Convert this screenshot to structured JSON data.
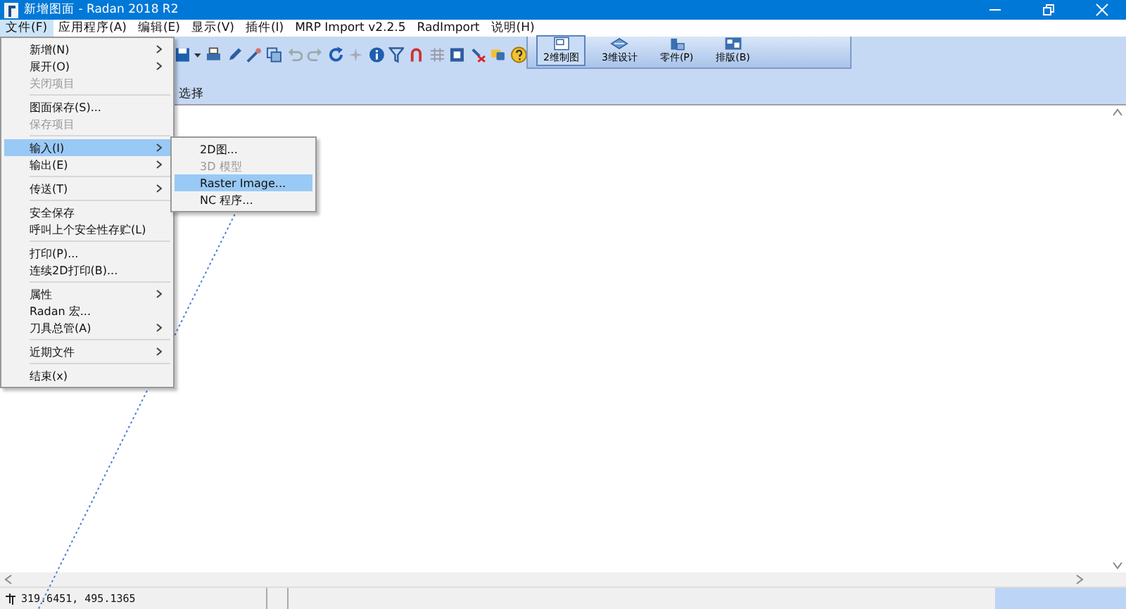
{
  "window": {
    "title": "新增图面 - Radan 2018 R2"
  },
  "menu_bar": [
    {
      "label": "文件(F)",
      "selected": true
    },
    {
      "label": "应用程序(A)",
      "selected": false
    },
    {
      "label": "编辑(E)",
      "selected": false
    },
    {
      "label": "显示(V)",
      "selected": false
    },
    {
      "label": "插件(I)",
      "selected": false
    },
    {
      "label": "MRP Import v2.2.5",
      "selected": false
    },
    {
      "label": "RadImport",
      "selected": false
    },
    {
      "label": "说明(H)",
      "selected": false
    }
  ],
  "ribbon_buttons": [
    {
      "label": "2维制图",
      "selected": true
    },
    {
      "label": "3维设计",
      "selected": false
    },
    {
      "label": "零件(P)",
      "selected": false
    },
    {
      "label": "排版(B)",
      "selected": false
    }
  ],
  "second_toolbar": {
    "label": "选择"
  },
  "file_menu": [
    {
      "kind": "item",
      "label": "新增(N)",
      "submenu": true,
      "disabled": false,
      "selected": false
    },
    {
      "kind": "item",
      "label": "展开(O)",
      "submenu": true,
      "disabled": false,
      "selected": false
    },
    {
      "kind": "item",
      "label": "关闭项目",
      "submenu": false,
      "disabled": true,
      "selected": false
    },
    {
      "kind": "separator"
    },
    {
      "kind": "item",
      "label": "图面保存(S)...",
      "submenu": false,
      "disabled": false,
      "selected": false
    },
    {
      "kind": "item",
      "label": "保存项目",
      "submenu": false,
      "disabled": true,
      "selected": false
    },
    {
      "kind": "separator"
    },
    {
      "kind": "item",
      "label": "输入(I)",
      "submenu": true,
      "disabled": false,
      "selected": true
    },
    {
      "kind": "item",
      "label": "输出(E)",
      "submenu": true,
      "disabled": false,
      "selected": false
    },
    {
      "kind": "separator"
    },
    {
      "kind": "item",
      "label": "传送(T)",
      "submenu": true,
      "disabled": false,
      "selected": false
    },
    {
      "kind": "separator"
    },
    {
      "kind": "item",
      "label": "安全保存",
      "submenu": false,
      "disabled": false,
      "selected": false
    },
    {
      "kind": "item",
      "label": "呼叫上个安全性存贮(L)",
      "submenu": false,
      "disabled": false,
      "selected": false
    },
    {
      "kind": "separator"
    },
    {
      "kind": "item",
      "label": "打印(P)...",
      "submenu": false,
      "disabled": false,
      "selected": false
    },
    {
      "kind": "item",
      "label": "连续2D打印(B)...",
      "submenu": false,
      "disabled": false,
      "selected": false
    },
    {
      "kind": "separator"
    },
    {
      "kind": "item",
      "label": "属性",
      "submenu": true,
      "disabled": false,
      "selected": false
    },
    {
      "kind": "item",
      "label": "Radan 宏...",
      "submenu": false,
      "disabled": false,
      "selected": false
    },
    {
      "kind": "item",
      "label": "刀具总管(A)",
      "submenu": true,
      "disabled": false,
      "selected": false
    },
    {
      "kind": "separator"
    },
    {
      "kind": "item",
      "label": "近期文件",
      "submenu": true,
      "disabled": false,
      "selected": false
    },
    {
      "kind": "separator"
    },
    {
      "kind": "item",
      "label": "结束(x)",
      "submenu": false,
      "disabled": false,
      "selected": false
    }
  ],
  "input_submenu": [
    {
      "label": "2D图...",
      "disabled": false,
      "selected": false
    },
    {
      "label": "3D 模型",
      "disabled": true,
      "selected": false
    },
    {
      "label": "Raster Image...",
      "disabled": false,
      "selected": true
    },
    {
      "label": "NC 程序...",
      "disabled": false,
      "selected": false
    }
  ],
  "status_bar": {
    "coordinates": "319.6451, 495.1365"
  }
}
